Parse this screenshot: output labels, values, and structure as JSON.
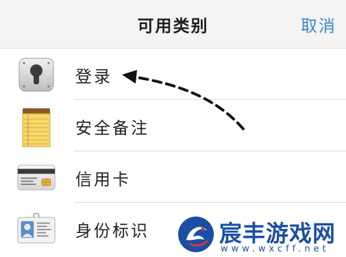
{
  "nav": {
    "title": "可用类别",
    "cancel": "取消"
  },
  "categories": [
    {
      "label": "登录",
      "icon": "keyhole-lock-icon"
    },
    {
      "label": "安全备注",
      "icon": "notepad-icon"
    },
    {
      "label": "信用卡",
      "icon": "credit-card-icon"
    },
    {
      "label": "身份标识",
      "icon": "id-card-icon"
    }
  ],
  "watermark": {
    "name": "宸丰游戏网",
    "url": "www.wxcff.net"
  },
  "colors": {
    "accent": "#3a88c9",
    "nav_bg": "#f4f4f4",
    "watermark": "#1a4fa3"
  }
}
